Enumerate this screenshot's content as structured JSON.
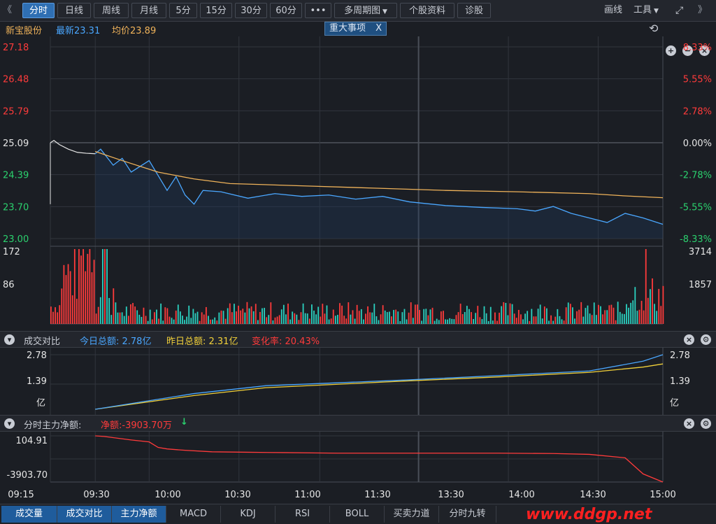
{
  "toolbar": {
    "back_glyph": "《",
    "tabs": [
      {
        "label": "分时",
        "active": true
      },
      {
        "label": "日线"
      },
      {
        "label": "周线"
      },
      {
        "label": "月线"
      },
      {
        "label": "5分"
      },
      {
        "label": "15分"
      },
      {
        "label": "30分"
      },
      {
        "label": "60分"
      },
      {
        "label": "•••"
      },
      {
        "label": "多周期图"
      },
      {
        "label": "个股资料"
      },
      {
        "label": "诊股"
      }
    ],
    "draw_label": "画线",
    "tools_label": "工具",
    "fullscreen_icon": "expand-icon",
    "forward_glyph": "》"
  },
  "quote": {
    "name": "新宝股份",
    "latest_label": "最新23.31",
    "avg_label": "均价23.89",
    "event_tag": "重大事项",
    "event_close": "X"
  },
  "colors": {
    "up": "#ff3b3b",
    "down": "#2bd16e",
    "price_line": "#4aa7ff",
    "avg_line": "#f0b35a",
    "yesterday_line": "#f2d13a",
    "net_line": "#ff3b3b",
    "accent": "#2f6fb3"
  },
  "chart_data": [
    {
      "type": "line",
      "title": "分时",
      "x_ticks": [
        "09:15",
        "09:30",
        "10:00",
        "10:30",
        "11:00",
        "11:30",
        "13:30",
        "14:00",
        "14:30",
        "15:00"
      ],
      "y_ticks_left": [
        "27.18",
        "26.48",
        "25.79",
        "25.09",
        "24.39",
        "23.70",
        "23.00"
      ],
      "y_ticks_right": [
        "8.33%",
        "5.55%",
        "2.78%",
        "0.00%",
        "-2.78%",
        "-5.55%",
        "-8.33%"
      ],
      "ylim": [
        23.0,
        27.18
      ],
      "prev_close": 25.09,
      "series": [
        {
          "name": "最新",
          "x": [
            0,
            25,
            28,
            35,
            40,
            45,
            55,
            65,
            70,
            75,
            80,
            85,
            95,
            110,
            125,
            140,
            155,
            170,
            185,
            200,
            220,
            240,
            260,
            270,
            280,
            290,
            300,
            310,
            320,
            330,
            341
          ],
          "values": [
            24.85,
            24.85,
            24.95,
            24.6,
            24.75,
            24.45,
            24.7,
            24.05,
            24.35,
            23.95,
            23.75,
            24.05,
            24.02,
            23.88,
            23.98,
            23.92,
            23.95,
            23.86,
            23.92,
            23.8,
            23.72,
            23.68,
            23.65,
            23.6,
            23.7,
            23.55,
            23.45,
            23.35,
            23.55,
            23.45,
            23.31
          ]
        },
        {
          "name": "均价",
          "x": [
            25,
            40,
            60,
            80,
            100,
            140,
            180,
            220,
            260,
            300,
            320,
            341
          ],
          "values": [
            24.9,
            24.7,
            24.45,
            24.3,
            24.2,
            24.15,
            24.1,
            24.05,
            24.02,
            23.98,
            23.93,
            23.89
          ]
        }
      ]
    },
    {
      "type": "bar",
      "title": "成交量",
      "y_ticks_left": [
        "172",
        "86"
      ],
      "y_ticks_right": [
        "3714",
        "1857"
      ],
      "ylim": [
        0,
        172
      ]
    },
    {
      "type": "line",
      "title": "成交对比",
      "y_ticks": [
        "2.78",
        "1.39",
        "亿"
      ],
      "ylim": [
        0,
        2.78
      ],
      "series": [
        {
          "name": "今日总额",
          "x": [
            25,
            80,
            120,
            200,
            250,
            300,
            330,
            341
          ],
          "values": [
            0.0,
            0.8,
            1.2,
            1.5,
            1.72,
            1.95,
            2.45,
            2.78
          ]
        },
        {
          "name": "昨日总额",
          "x": [
            25,
            80,
            120,
            200,
            250,
            300,
            330,
            341
          ],
          "values": [
            0.0,
            0.7,
            1.1,
            1.45,
            1.65,
            1.88,
            2.15,
            2.31
          ]
        }
      ]
    },
    {
      "type": "line",
      "title": "分时主力净额",
      "y_ticks": [
        "104.91",
        "-3903.70"
      ],
      "ylim": [
        -3903.7,
        104.91
      ],
      "series": [
        {
          "name": "净额",
          "x": [
            25,
            30,
            45,
            55,
            60,
            65,
            75,
            90,
            110,
            130,
            160,
            200,
            250,
            280,
            300,
            320,
            330,
            341
          ],
          "values": [
            104.91,
            50,
            -250,
            -420,
            -900,
            -1030,
            -1150,
            -1280,
            -1320,
            -1350,
            -1400,
            -1400,
            -1400,
            -1430,
            -1500,
            -1800,
            -3200,
            -3903.7
          ]
        }
      ]
    }
  ],
  "panels": {
    "compare": {
      "title": "成交对比",
      "today_label": "今日总额: 2.78亿",
      "yesterday_label": "昨日总额: 2.31亿",
      "change_label": "变化率: 20.43%"
    },
    "net": {
      "title": "分时主力净额:",
      "net_label": "净额:-3903.70万",
      "trend_glyph": "↓"
    }
  },
  "bottom_tabs": [
    {
      "label": "成交量",
      "active": true
    },
    {
      "label": "成交对比",
      "active": true
    },
    {
      "label": "主力净额",
      "active": true
    },
    {
      "label": "MACD"
    },
    {
      "label": "KDJ"
    },
    {
      "label": "RSI"
    },
    {
      "label": "BOLL"
    },
    {
      "label": "买卖力道"
    },
    {
      "label": "分时九转"
    }
  ],
  "watermark": "www.ddgp.net"
}
